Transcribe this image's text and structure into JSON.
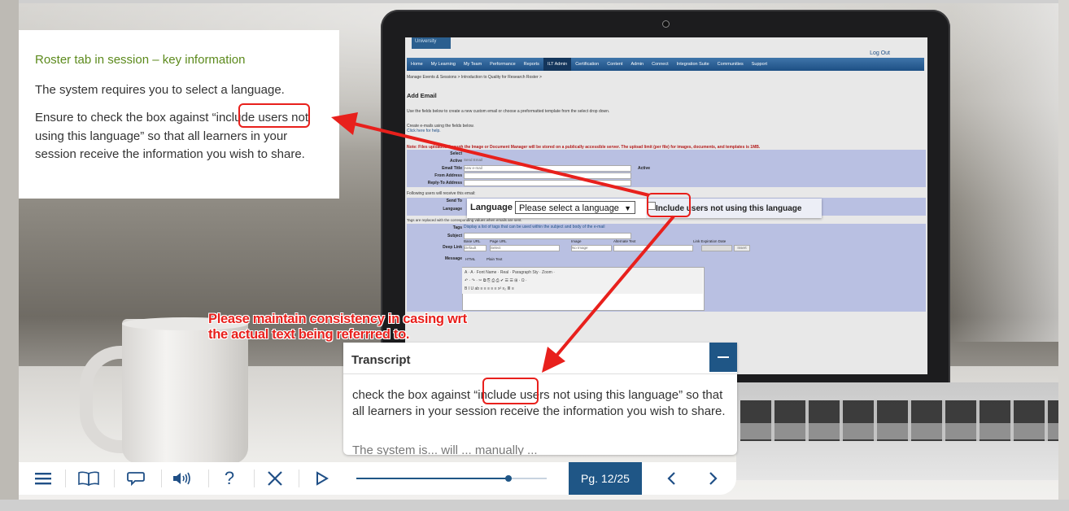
{
  "info_panel": {
    "title": "Roster tab in session – key information",
    "paragraph1": "The system requires you to select a language.",
    "paragraph2": "Ensure to check the box against “include users not using this language” so that all learners in your session receive the information you wish to share."
  },
  "screen": {
    "university_label": "University",
    "logout_label": "Log Out",
    "nav_items": [
      "Home",
      "My Learning",
      "My Team",
      "Performance",
      "Reports",
      "ILT Admin",
      "Certification",
      "Content",
      "Admin",
      "Connect",
      "Integration Suite",
      "Communities",
      "Support"
    ],
    "active_nav": "ILT Admin",
    "breadcrumb": "Manage Events & Sessions  >  Introduction to Quality for Research Roster  >",
    "heading": "Add Email",
    "intro_text": "Use the fields below to create a new custom email or choose a preformatted template from the select drop down.",
    "create_text": "Create e-mails using the fields below.",
    "help_link": "Click here for help.",
    "note_text": "Note: Files uploaded through the Image or Document Manager will be stored on a publically accessible server. The upload limit (per file) for images, documents, and templates is 1MB.",
    "form_labels": [
      "Select",
      "Active",
      "Email Title",
      "From Address",
      "Reply-To Address"
    ],
    "active_value": "Send Email",
    "email_title_value": "new e-mail",
    "active_checkbox_label": "Active",
    "following_text": "Following users will receive this email:",
    "send_to_label": "Send To",
    "language_label_small": "Language",
    "tags_note": "Tags are replaced with the corresponding values when emails are sent.",
    "tags_label": "Tags",
    "tags_text": "Display a list of tags that can be used within the subject and body of the e-mail",
    "subject_label": "Subject",
    "deep_link_label": "Deep Link",
    "base_url_label": "Base URL",
    "base_url_value": "Default",
    "page_url_label": "Page URL",
    "page_url_value": "Select",
    "image_label": "Image",
    "image_value": "No Image",
    "alt_text_label": "Alternate Text",
    "link_exp_label": "Link Expiration Date",
    "insert_label": "Insert",
    "message_label": "Message",
    "format_html": "HTML",
    "format_plain": "Plain Text",
    "toolbar_row1": "A · A ·  Font Name ·  Real ·  Paragraph Sty ·  Zoom ·",
    "toolbar_row2": "↶ · ↷ ·  ✂  ⧉  ⎘  ⎙  ⎙  ✔  ☰  ☰  ⊞  ·  Ω ·",
    "toolbar_row3": "B  I  U  ab  ≡  ≡  ≡  ≡  ≡  x²  x₂  ≣  ≡"
  },
  "language_bar": {
    "label": "Language",
    "select_value": "Please select a language",
    "checkbox_label": "Include users not using this language",
    "checked": false
  },
  "annotation": {
    "text": "Please maintain consistency in casing wrt the actual text being referrred to.",
    "color": "#e8201c"
  },
  "transcript": {
    "title": "Transcript",
    "body": "check the box against “include users not using this language” so that all learners in your session receive the information you wish to share.",
    "fade_text": "The system is...  will ...  manually ..."
  },
  "player": {
    "page_label": "Pg. 12/25",
    "progress_fraction": 0.8,
    "icons": [
      "menu-icon",
      "book-icon",
      "speech-bubble-icon",
      "volume-icon",
      "help-icon",
      "close-icon",
      "play-icon",
      "chevron-left-icon",
      "chevron-right-icon"
    ],
    "help_glyph": "?",
    "accent": "#1f5686"
  }
}
